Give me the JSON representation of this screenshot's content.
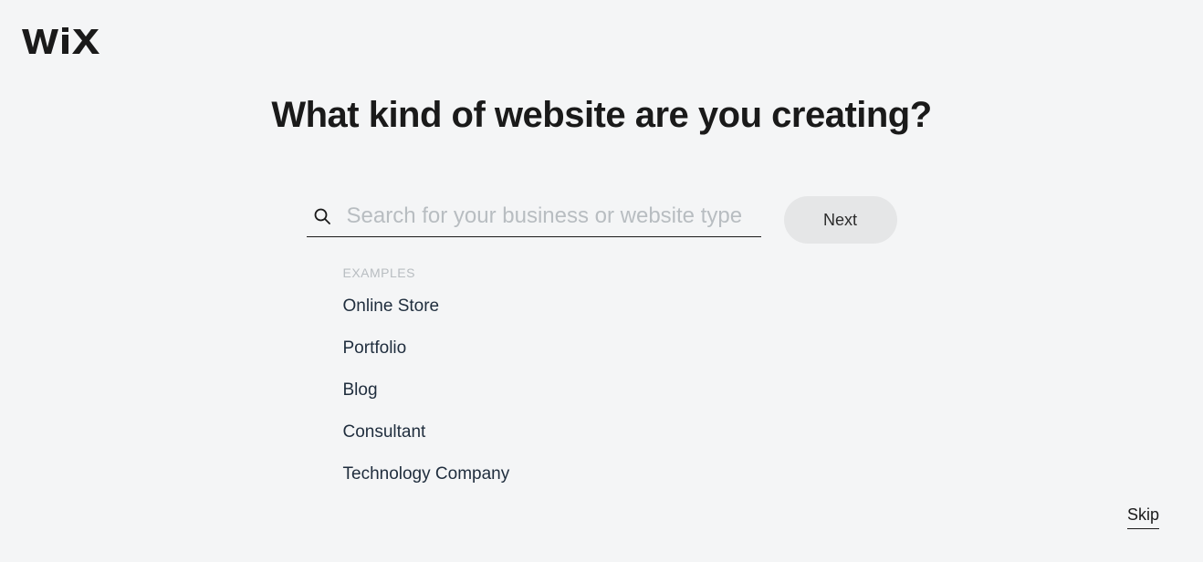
{
  "brand": "WIX",
  "heading": "What kind of website are you creating?",
  "search": {
    "placeholder": "Search for your business or website type",
    "value": ""
  },
  "buttons": {
    "next": "Next",
    "skip": "Skip"
  },
  "examples": {
    "label": "EXAMPLES",
    "items": [
      "Online Store",
      "Portfolio",
      "Blog",
      "Consultant",
      "Technology Company"
    ]
  }
}
